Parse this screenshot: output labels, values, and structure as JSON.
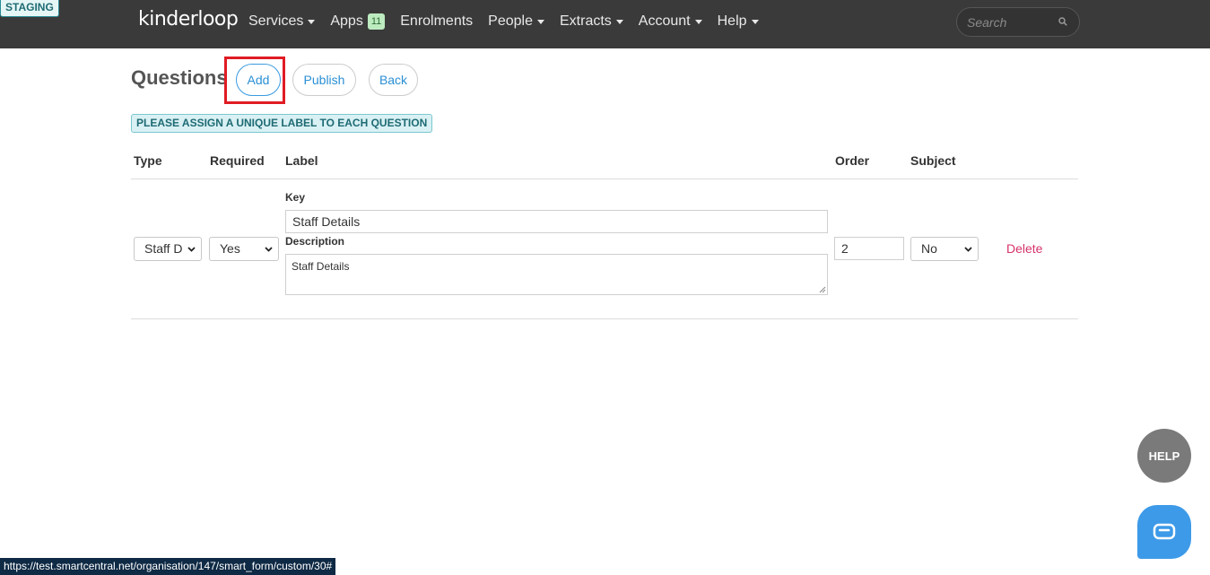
{
  "env_badge": "STAGING",
  "brand": "kinderloop",
  "nav": {
    "services": "Services",
    "apps": "Apps",
    "apps_count": "11",
    "enrolments": "Enrolments",
    "people": "People",
    "extracts": "Extracts",
    "account": "Account",
    "help": "Help"
  },
  "search": {
    "placeholder": "Search"
  },
  "page": {
    "title": "Questions",
    "add_label": "Add",
    "publish_label": "Publish",
    "back_label": "Back",
    "notice": "PLEASE ASSIGN A UNIQUE LABEL TO EACH QUESTION"
  },
  "table": {
    "headers": {
      "type": "Type",
      "required": "Required",
      "label": "Label",
      "order": "Order",
      "subject": "Subject"
    },
    "row": {
      "type_value": "Staff D",
      "required_value": "Yes",
      "key_label": "Key",
      "key_value": "Staff Details",
      "description_label": "Description",
      "description_value": "Staff Details",
      "order_value": "2",
      "subject_value": "No",
      "delete_label": "Delete"
    }
  },
  "help_button": "HELP",
  "status_url": "https://test.smartcentral.net/organisation/147/smart_form/custom/30#",
  "colors": {
    "accent": "#2a8fd4",
    "danger": "#d6336c",
    "highlight": "#e01b24",
    "topbar": "#3a3a3a"
  }
}
